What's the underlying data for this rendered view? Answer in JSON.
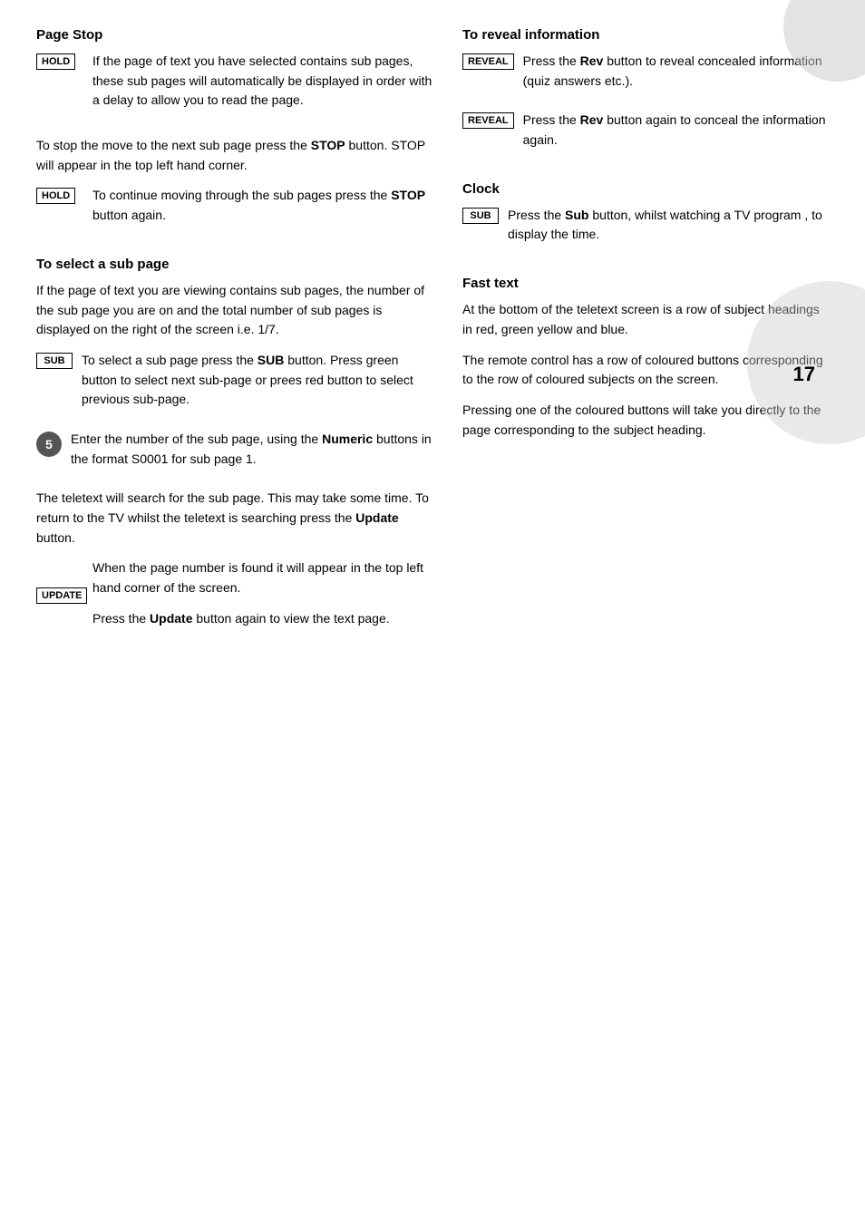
{
  "page": {
    "number": "17",
    "deco_circle1": true,
    "deco_circle2": true
  },
  "left_col": {
    "page_stop": {
      "title": "Page Stop",
      "hold_icon1": "HOLD",
      "para1": "If the page of text you have selected contains sub pages, these sub pages will automatically be displayed in order with a delay to allow you to read the page.",
      "para2_before_bold": "To stop the move to the next sub page press the ",
      "para2_bold": "STOP",
      "para2_after_bold": " button.  STOP will appear in the top left hand corner.",
      "hold_icon2": "HOLD",
      "para3_before_bold": "To continue moving through the sub pages press the ",
      "para3_bold": "STOP",
      "para3_after_bold": " button again."
    },
    "select_sub_page": {
      "title": "To select a sub page",
      "para1": "If the page of text you are viewing contains sub pages, the number of the sub page you are on and the total number of sub pages is displayed on the right of the screen i.e. 1/7.",
      "sub_icon": "SUB",
      "para2_before_bold1": "To select a sub page press the ",
      "para2_bold1": "SUB",
      "para2_after_bold1": " button. Press green button to select next sub-page or prees red  button to select previous sub-page.",
      "num_icon": "5",
      "para3_before_bold": "Enter the number of the sub page, using the ",
      "para3_bold": "Numeric",
      "para3_after_bold": " buttons in the format S0001 for sub page 1.",
      "para4_before_bold": "The teletext will search for the sub page.  This may take some time.  To return to the TV whilst the teletext is searching press the ",
      "para4_bold": "Update",
      "para4_after_bold": " button.",
      "para5": "When the page number is found it will appear in the top left hand corner of the screen.",
      "update_icon": "UPDATE",
      "para6_before_bold": "Press the ",
      "para6_bold": "Update",
      "para6_after_bold": "  button again to view the text page."
    }
  },
  "right_col": {
    "reveal_info": {
      "title": "To reveal information",
      "reveal_icon1": "REVEAL",
      "para1_before_bold": "Press the ",
      "para1_bold": "Rev",
      "para1_after_bold": " button to reveal concealed information (quiz answers etc.).",
      "reveal_icon2": "REVEAL",
      "para2_before_bold": "Press the ",
      "para2_bold": "Rev",
      "para2_after_bold": " button again to conceal the  information again."
    },
    "clock": {
      "title": "Clock",
      "sub_icon": "SUB",
      "para1_before_bold": "Press the ",
      "para1_bold": "Sub",
      "para1_after_bold": " button, whilst watching a TV program , to display the time."
    },
    "fast_text": {
      "title": "Fast text",
      "para1": "At the bottom of the teletext screen is a row of subject headings in red, green yellow and blue.",
      "para2": "The remote control has a row of coloured buttons corresponding to the row of coloured subjects on the screen.",
      "para3": "Pressing one of the coloured buttons will take you directly to the page corresponding to the subject heading."
    }
  }
}
